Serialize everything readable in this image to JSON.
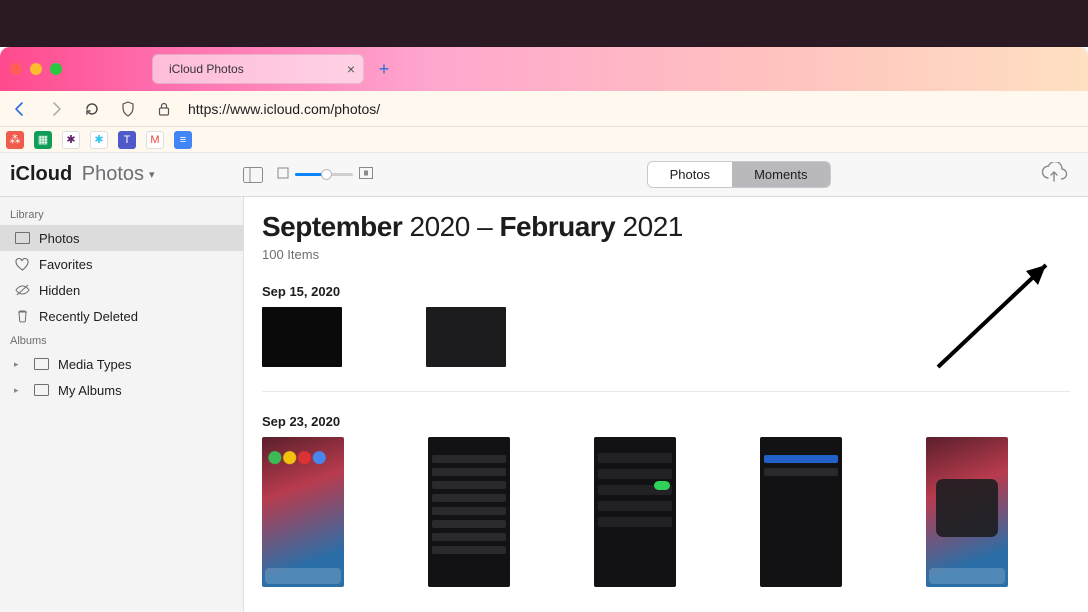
{
  "browser": {
    "tab_title": "iCloud Photos",
    "url": "https://www.icloud.com/photos/"
  },
  "app": {
    "brand_primary": "iCloud",
    "brand_secondary": "Photos",
    "segment": {
      "photos": "Photos",
      "moments": "Moments",
      "active": "moments"
    }
  },
  "sidebar": {
    "library_header": "Library",
    "albums_header": "Albums",
    "items": [
      {
        "label": "Photos"
      },
      {
        "label": "Favorites"
      },
      {
        "label": "Hidden"
      },
      {
        "label": "Recently Deleted"
      }
    ],
    "album_items": [
      {
        "label": "Media Types"
      },
      {
        "label": "My Albums"
      }
    ]
  },
  "content": {
    "title_month1": "September",
    "title_year1": "2020",
    "title_sep": "–",
    "title_month2": "February",
    "title_year2": "2021",
    "item_count": "100 Items",
    "groups": [
      {
        "date": "Sep 15, 2020"
      },
      {
        "date": "Sep 23, 2020"
      }
    ]
  }
}
